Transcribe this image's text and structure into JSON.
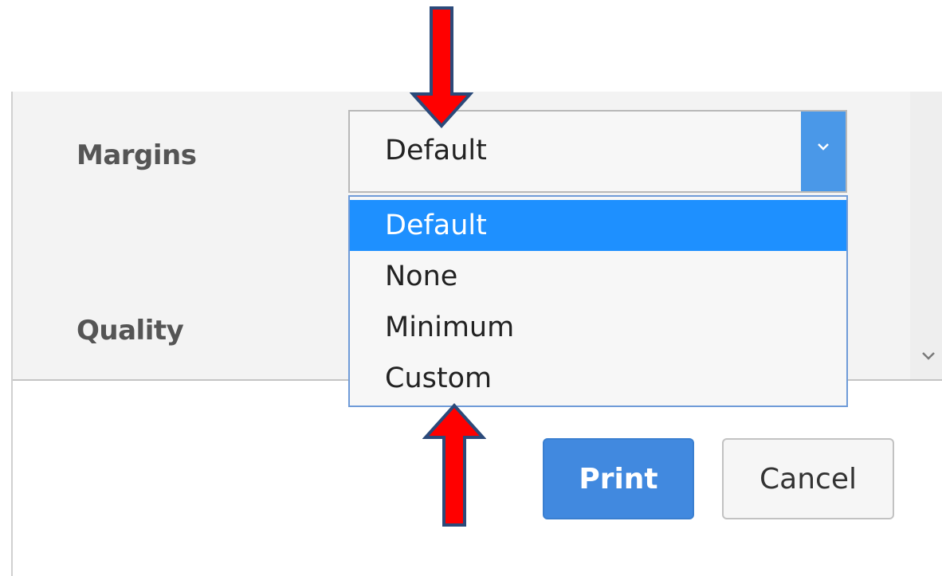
{
  "margins": {
    "label": "Margins",
    "selected_value": "Default",
    "options": [
      "Default",
      "None",
      "Minimum",
      "Custom"
    ],
    "selected_index": 0
  },
  "quality": {
    "label": "Quality"
  },
  "buttons": {
    "print_label": "Print",
    "cancel_label": "Cancel"
  },
  "icons": {
    "dropdown": "chevron-down-icon",
    "scroll": "chevron-down-icon",
    "annotation": "arrow-icon"
  },
  "colors": {
    "accent": "#1e90ff",
    "print_button": "#4189df",
    "dropdown_button": "#4a98e8",
    "annotation_arrow": "#ff0000",
    "annotation_outline": "#2b4a7a"
  }
}
